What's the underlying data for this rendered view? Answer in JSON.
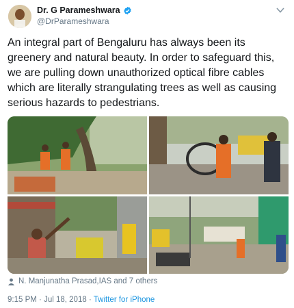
{
  "author": {
    "display_name": "Dr. G Parameshwara",
    "handle": "@DrParameshwara",
    "verified": true
  },
  "tweet": {
    "text": "An integral part of Bengaluru has always been its greenery and natural beauty. In order to safeguard this, we are pulling down unauthorized optical fibre cables which are literally strangulating trees as well as causing serious hazards to pedestrians."
  },
  "media": {
    "photo_count": 4
  },
  "tagged": {
    "text": "N. Manjunatha Prasad,IAS and 7 others"
  },
  "meta": {
    "time": "9:15 PM",
    "separator": "·",
    "date": "Jul 18, 2018",
    "source": "Twitter for iPhone"
  },
  "colors": {
    "link": "#1b95e0",
    "verified_badge": "#1da1f2",
    "secondary_text": "#657786"
  },
  "icons": {
    "verified": "verified-badge-icon",
    "menu": "chevron-down-icon",
    "tagged": "person-icon"
  }
}
